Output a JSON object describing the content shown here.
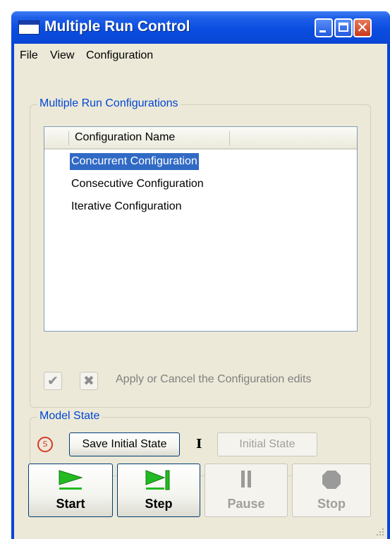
{
  "window": {
    "title": "Multiple Run Control"
  },
  "menu": [
    "File",
    "View",
    "Configuration"
  ],
  "configurations": {
    "group_title": "Multiple Run Configurations",
    "column_header": "Configuration Name",
    "rows": [
      "Concurrent Configuration",
      "Consecutive Configuration",
      "Iterative Configuration"
    ],
    "selected_row": "Concurrent Configuration",
    "apply_hint": "Apply or Cancel the Configuration edits"
  },
  "model_state": {
    "group_title": "Model State",
    "save_label": "Save Initial State",
    "initial_label": "Initial State"
  },
  "controls": {
    "start_label": "Start",
    "step_label": "Step",
    "pause_label": "Pause",
    "stop_label": "Stop"
  },
  "colors": {
    "titlebar": "#0a4de0",
    "selection": "#316ac5",
    "group_title": "#0046d5",
    "start_step_icon": "#22bb22"
  }
}
